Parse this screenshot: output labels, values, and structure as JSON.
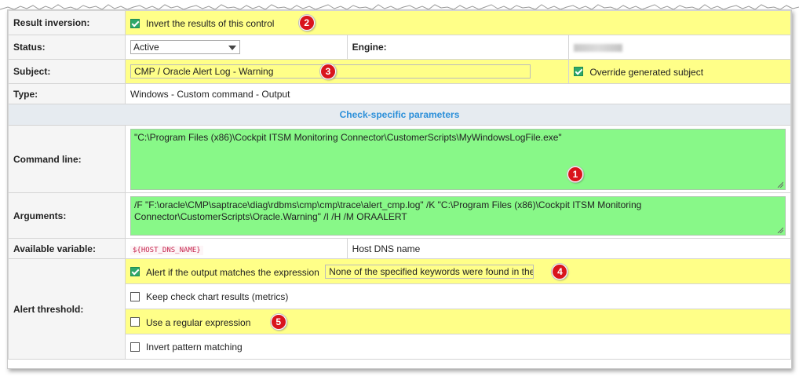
{
  "result_inversion": {
    "label": "Result inversion:",
    "checkbox_label": "Invert the results of this control",
    "checked": true,
    "badge": "2"
  },
  "status": {
    "label": "Status:",
    "value": "Active",
    "engine_label": "Engine:"
  },
  "subject": {
    "label": "Subject:",
    "value": "CMP / Oracle Alert Log - Warning",
    "badge": "3",
    "override_label": "Override generated subject",
    "override_checked": true
  },
  "type": {
    "label": "Type:",
    "value": "Windows - Custom command - Output"
  },
  "section": {
    "title": "Check-specific parameters"
  },
  "command_line": {
    "label": "Command line:",
    "value": "\"C:\\Program Files (x86)\\Cockpit ITSM Monitoring Connector\\CustomerScripts\\MyWindowsLogFile.exe\"",
    "badge": "1"
  },
  "arguments": {
    "label": "Arguments:",
    "value": "/F \"F:\\oracle\\CMP\\saptrace\\diag\\rdbms\\cmp\\cmp\\trace\\alert_cmp.log\" /K \"C:\\Program Files (x86)\\Cockpit ITSM Monitoring Connector\\CustomerScripts\\Oracle.Warning\" /I /H /M ORAALERT"
  },
  "available_variable": {
    "label": "Available variable:",
    "variable": "${HOST_DNS_NAME}",
    "description": "Host DNS name"
  },
  "alert_threshold": {
    "label": "Alert threshold:",
    "options": [
      {
        "label": "Alert if the output matches the expression",
        "checked": true,
        "value": "None of the specified keywords were found in the",
        "badge": "4"
      },
      {
        "label": "Keep check chart results (metrics)",
        "checked": false
      },
      {
        "label": "Use a regular expression",
        "checked": false,
        "badge": "5"
      },
      {
        "label": "Invert pattern matching",
        "checked": false
      }
    ]
  },
  "colors": {
    "highlight_yellow": "#ffff88",
    "highlight_green": "#88f888",
    "badge_red": "#d9141c",
    "section_blue": "#2b8fd9",
    "check_green": "#2ea86a"
  }
}
